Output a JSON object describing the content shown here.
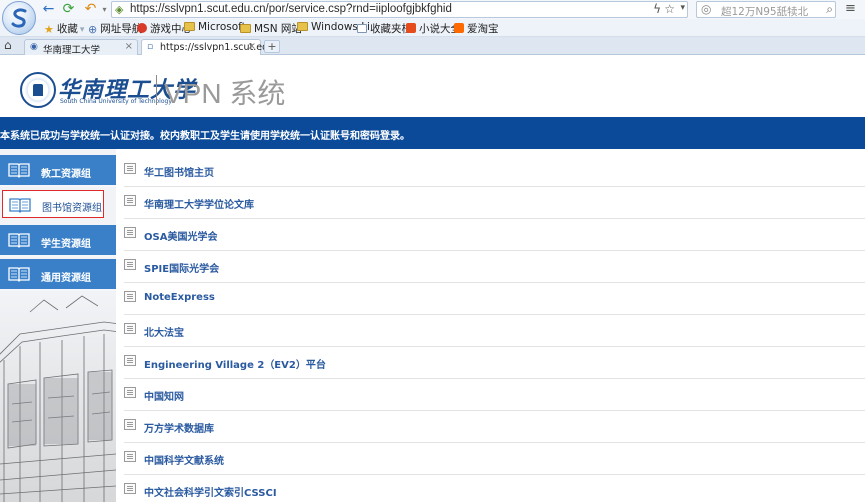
{
  "browser": {
    "address_url": "https://sslvpn1.scut.edu.cn/por/service.csp?rnd=iiploofgjbkfghid",
    "search_placeholder": "超12万N95舐犊北"
  },
  "bookmarks": [
    {
      "label": "收藏",
      "icon": "star-icon"
    },
    {
      "label": "网址导航",
      "icon": "globe-icon"
    },
    {
      "label": "游戏中心",
      "icon": "game-icon"
    },
    {
      "label": "Microsoft",
      "icon": "folder-icon"
    },
    {
      "label": "MSN 网站",
      "icon": "folder-icon"
    },
    {
      "label": "Windows Li",
      "icon": "folder-icon"
    },
    {
      "label": "收藏夹栏",
      "icon": "box-icon"
    },
    {
      "label": "小说大全",
      "icon": "novel-icon"
    },
    {
      "label": "爱淘宝",
      "icon": "shop-icon"
    }
  ],
  "tabs": [
    {
      "label": "华南理工大学",
      "active": false
    },
    {
      "label": "https://sslvpn1.scut.ed",
      "active": true
    }
  ],
  "header": {
    "school_cn": "华南理工大学",
    "school_en": "South China University of Technology",
    "title": "VPN 系统"
  },
  "notice": "本系统已成功与学校统一认证对接。校内教职工及学生请使用学校统一认证账号和密码登录。",
  "sidebar": {
    "items": [
      {
        "label": "教工资源组",
        "selected": false
      },
      {
        "label": "图书馆资源组",
        "selected": true
      },
      {
        "label": "学生资源组",
        "selected": false
      },
      {
        "label": "通用资源组",
        "selected": false
      }
    ]
  },
  "resources": [
    "华工图书馆主页",
    "华南理工大学学位论文库",
    "OSA美国光学会",
    "SPIE国际光学会",
    "NoteExpress",
    "北大法宝",
    "Engineering Village 2（EV2）平台",
    "中国知网",
    "万方学术数据库",
    "中国科学文献系统",
    "中文社会科学引文索引CSSCI"
  ],
  "colors": {
    "notice_bg": "#0b4a99",
    "sidebar_item_bg": "#3a80c9",
    "selected_border": "#e02a2a",
    "link_text": "#2a5aa0"
  }
}
